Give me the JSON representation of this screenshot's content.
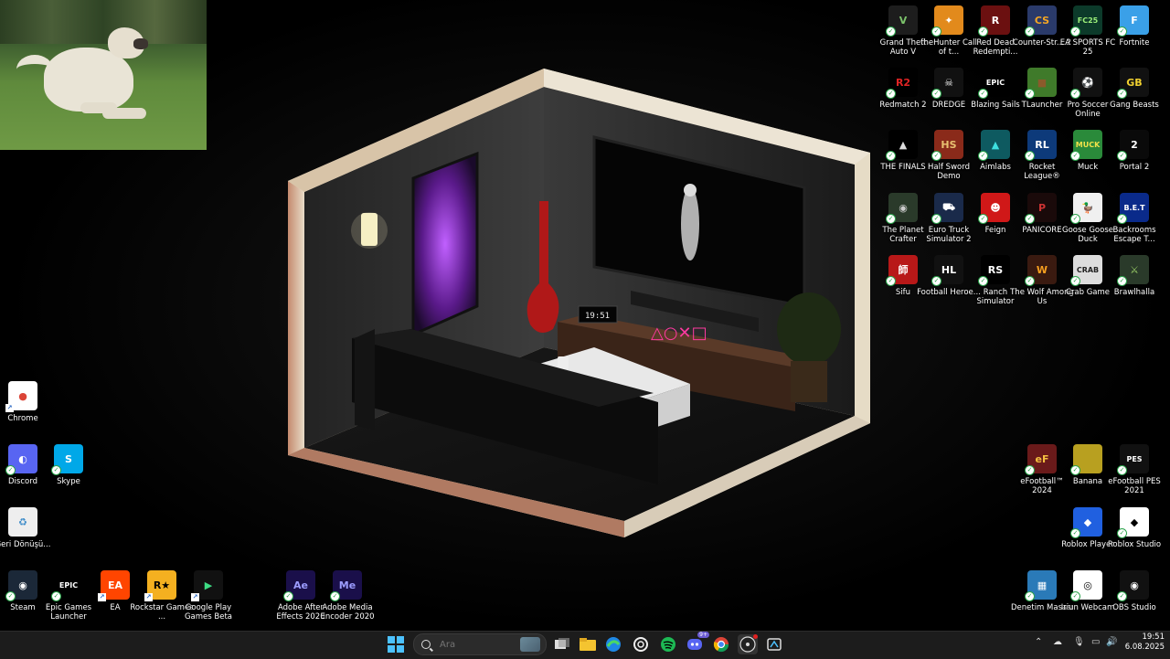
{
  "desktop": {
    "icons": [
      {
        "id": "gta",
        "label": "Grand Theft Auto V",
        "col": "r1",
        "row": 0,
        "bg": "#1d1d1d",
        "fg": "#7cc36b",
        "glyph": "V"
      },
      {
        "id": "thehunter",
        "label": "theHunter Call of t...",
        "col": "r2",
        "row": 0,
        "bg": "#e28a1c",
        "fg": "#fff",
        "glyph": "✦"
      },
      {
        "id": "rdr",
        "label": "Red Dead Redempti...",
        "col": "r3",
        "row": 0,
        "bg": "#6b1010",
        "fg": "#fff",
        "glyph": "R"
      },
      {
        "id": "cs2",
        "label": "Counter-Str... 2",
        "col": "r4",
        "row": 0,
        "bg": "#2a3a6a",
        "fg": "#f5a623",
        "glyph": "CS"
      },
      {
        "id": "fc25",
        "label": "EA SPORTS FC 25",
        "col": "r5",
        "row": 0,
        "bg": "#0c3a2a",
        "fg": "#9cf07a",
        "glyph": "FC25"
      },
      {
        "id": "fortnite",
        "label": "Fortnite",
        "col": "r6",
        "row": 0,
        "bg": "#3aa0e8",
        "fg": "#fff",
        "glyph": "F"
      },
      {
        "id": "redmatch",
        "label": "Redmatch 2",
        "col": "r1",
        "row": 1,
        "bg": "#000",
        "fg": "#e02424",
        "glyph": "R2"
      },
      {
        "id": "dredge",
        "label": "DREDGE",
        "col": "r2",
        "row": 1,
        "bg": "#111",
        "fg": "#eee",
        "glyph": "☠"
      },
      {
        "id": "epic1",
        "label": "Blazing Sails",
        "col": "r3",
        "row": 1,
        "bg": "#000",
        "fg": "#fff",
        "glyph": "EPIC"
      },
      {
        "id": "tlauncher",
        "label": "TLauncher",
        "col": "r4",
        "row": 1,
        "bg": "#3f7a2a",
        "fg": "#8b5a2b",
        "glyph": "■"
      },
      {
        "id": "prosoccer",
        "label": "Pro Soccer Online",
        "col": "r5",
        "row": 1,
        "bg": "#111",
        "fg": "#fff",
        "glyph": "⚽"
      },
      {
        "id": "gangbeasts",
        "label": "Gang Beasts",
        "col": "r6",
        "row": 1,
        "bg": "#111",
        "fg": "#f0d030",
        "glyph": "GB"
      },
      {
        "id": "thefinals",
        "label": "THE FINALS",
        "col": "r1",
        "row": 2,
        "bg": "#000",
        "fg": "#ddd",
        "glyph": "▲"
      },
      {
        "id": "halfsword",
        "label": "Half Sword Demo",
        "col": "r2",
        "row": 2,
        "bg": "#8a2a1a",
        "fg": "#e8c070",
        "glyph": "HS"
      },
      {
        "id": "aimlabs",
        "label": "Aimlabs",
        "col": "r3",
        "row": 2,
        "bg": "#0e5a60",
        "fg": "#3ee0e0",
        "glyph": "▲"
      },
      {
        "id": "rocketleague",
        "label": "Rocket League®",
        "col": "r4",
        "row": 2,
        "bg": "#0d3a7a",
        "fg": "#fff",
        "glyph": "RL"
      },
      {
        "id": "muck",
        "label": "Muck",
        "col": "r5",
        "row": 2,
        "bg": "#2a8a3a",
        "fg": "#f2e24a",
        "glyph": "MUCK"
      },
      {
        "id": "portal2",
        "label": "Portal 2",
        "col": "r6",
        "row": 2,
        "bg": "#0a0a0a",
        "fg": "#fff",
        "glyph": "2"
      },
      {
        "id": "planetcrafter",
        "label": "The Planet Crafter",
        "col": "r1",
        "row": 3,
        "bg": "#2a3a2a",
        "fg": "#ccc",
        "glyph": "◉"
      },
      {
        "id": "ets2",
        "label": "Euro Truck Simulator 2",
        "col": "r2",
        "row": 3,
        "bg": "#1a2a4a",
        "fg": "#fff",
        "glyph": "⛟"
      },
      {
        "id": "feign",
        "label": "Feign",
        "col": "r3",
        "row": 3,
        "bg": "#d01818",
        "fg": "#fff",
        "glyph": "☻"
      },
      {
        "id": "panicore",
        "label": "PANICORE",
        "col": "r4",
        "row": 3,
        "bg": "#1a0a0a",
        "fg": "#c33",
        "glyph": "P"
      },
      {
        "id": "goosegoose",
        "label": "Goose Goose Duck",
        "col": "r5",
        "row": 3,
        "bg": "#f0f0f0",
        "fg": "#222",
        "glyph": "🦆"
      },
      {
        "id": "backrooms",
        "label": "Backrooms Escape T...",
        "col": "r6",
        "row": 3,
        "bg": "#0a2a8a",
        "fg": "#fff",
        "glyph": "B.E.T"
      },
      {
        "id": "sifu",
        "label": "Sifu",
        "col": "r1",
        "row": 4,
        "bg": "#b81818",
        "fg": "#fff",
        "glyph": "師"
      },
      {
        "id": "footballheroes",
        "label": "Football Heroe...",
        "col": "r2",
        "row": 4,
        "bg": "#111",
        "fg": "#fff",
        "glyph": "HL"
      },
      {
        "id": "ranchsim",
        "label": "Ranch Simulator",
        "col": "r3",
        "row": 4,
        "bg": "#000",
        "fg": "#fff",
        "glyph": "RS"
      },
      {
        "id": "wolfamong",
        "label": "The Wolf Among Us",
        "col": "r4",
        "row": 4,
        "bg": "#3a1a10",
        "fg": "#f8a020",
        "glyph": "W"
      },
      {
        "id": "crabgame",
        "label": "Crab Game",
        "col": "r5",
        "row": 4,
        "bg": "#ddd",
        "fg": "#222",
        "glyph": "CRAB"
      },
      {
        "id": "brawlhalla",
        "label": "Brawlhalla",
        "col": "r6",
        "row": 4,
        "bg": "#2a3a2a",
        "fg": "#9c6",
        "glyph": "⚔"
      },
      {
        "id": "efootball2024",
        "label": "eFootball™ 2024",
        "col": "r4",
        "row": 7,
        "bg": "#6a1a1a",
        "fg": "#f4c040",
        "glyph": "eF"
      },
      {
        "id": "banana",
        "label": "Banana",
        "col": "r5",
        "row": 7,
        "bg": "#b8a020",
        "fg": "#fff",
        "glyph": ""
      },
      {
        "id": "efootballpes",
        "label": "eFootball PES 2021",
        "col": "r6",
        "row": 7,
        "bg": "#111",
        "fg": "#fff",
        "glyph": "PES"
      },
      {
        "id": "robloxplayer",
        "label": "Roblox Player",
        "col": "r5",
        "row": 8,
        "bg": "#2060e0",
        "fg": "#fff",
        "glyph": "◆"
      },
      {
        "id": "robloxstudio",
        "label": "Roblox Studio",
        "col": "r6",
        "row": 8,
        "bg": "#fff",
        "fg": "#000",
        "glyph": "◆"
      },
      {
        "id": "denetim",
        "label": "Denetim Masası",
        "col": "r4",
        "row": 9,
        "bg": "#2a7ab8",
        "fg": "#fff",
        "glyph": "▦"
      },
      {
        "id": "iriun",
        "label": "Iriun Webcam",
        "col": "r5",
        "row": 9,
        "bg": "#fff",
        "fg": "#000",
        "glyph": "◎"
      },
      {
        "id": "obs",
        "label": "OBS Studio",
        "col": "r6",
        "row": 9,
        "bg": "#111",
        "fg": "#fff",
        "glyph": "◉"
      },
      {
        "id": "chrome",
        "label": "Chrome",
        "col": "l1",
        "row": 6,
        "bg": "#fff",
        "fg": "#db4437",
        "glyph": "●"
      },
      {
        "id": "discord",
        "label": "Discord",
        "col": "l1",
        "row": 7,
        "bg": "#5865f2",
        "fg": "#fff",
        "glyph": "◐"
      },
      {
        "id": "skype",
        "label": "Skype",
        "col": "l2",
        "row": 7,
        "bg": "#00a8e8",
        "fg": "#fff",
        "glyph": "S"
      },
      {
        "id": "geri",
        "label": "Geri Dönüşü...",
        "col": "l1",
        "row": 8,
        "bg": "#eee",
        "fg": "#3a8ac8",
        "glyph": "♻"
      },
      {
        "id": "steam",
        "label": "Steam",
        "col": "l1",
        "row": 9,
        "bg": "#1b2838",
        "fg": "#fff",
        "glyph": "◉"
      },
      {
        "id": "epiclauncher",
        "label": "Epic Games Launcher",
        "col": "l2",
        "row": 9,
        "bg": "#000",
        "fg": "#fff",
        "glyph": "EPIC"
      },
      {
        "id": "ea",
        "label": "EA",
        "col": "l3",
        "row": 9,
        "bg": "#ff4500",
        "fg": "#fff",
        "glyph": "EA"
      },
      {
        "id": "rockstar",
        "label": "Rockstar Games ...",
        "col": "l4",
        "row": 9,
        "bg": "#f4b020",
        "fg": "#000",
        "glyph": "R★"
      },
      {
        "id": "googleplay",
        "label": "Google Play Games Beta",
        "col": "l5",
        "row": 9,
        "bg": "#111",
        "fg": "#3ddc84",
        "glyph": "▶"
      },
      {
        "id": "aftereffects",
        "label": "Adobe After Effects 2020",
        "col": "l7",
        "row": 9,
        "bg": "#1a0f4a",
        "fg": "#9c9cff",
        "glyph": "Ae"
      },
      {
        "id": "mediaencoder",
        "label": "Adobe Media Encoder 2020",
        "col": "l8",
        "row": 9,
        "bg": "#1a0f4a",
        "fg": "#9c9cff",
        "glyph": "Me"
      }
    ]
  },
  "room": {
    "clock_text": "19:51",
    "ps_symbols": "△○✕□"
  },
  "taskbar": {
    "search_placeholder": "Ara",
    "apps": [
      {
        "id": "taskview",
        "icon": "taskview-icon"
      },
      {
        "id": "explorer",
        "icon": "folder-icon"
      },
      {
        "id": "edge",
        "icon": "edge-icon"
      },
      {
        "id": "chatgpt",
        "icon": "chatgpt-icon"
      },
      {
        "id": "spotify",
        "icon": "spotify-icon"
      },
      {
        "id": "discord",
        "icon": "discord-icon",
        "badge": "9+"
      },
      {
        "id": "chrome",
        "icon": "chrome-icon"
      },
      {
        "id": "obs",
        "icon": "obs-icon"
      },
      {
        "id": "app",
        "icon": "app-icon"
      }
    ],
    "time": "19:51",
    "date": "6.08.2025"
  },
  "colors": {
    "accent": "#4cc2ff",
    "taskbar_bg": "#1c1c1c"
  }
}
